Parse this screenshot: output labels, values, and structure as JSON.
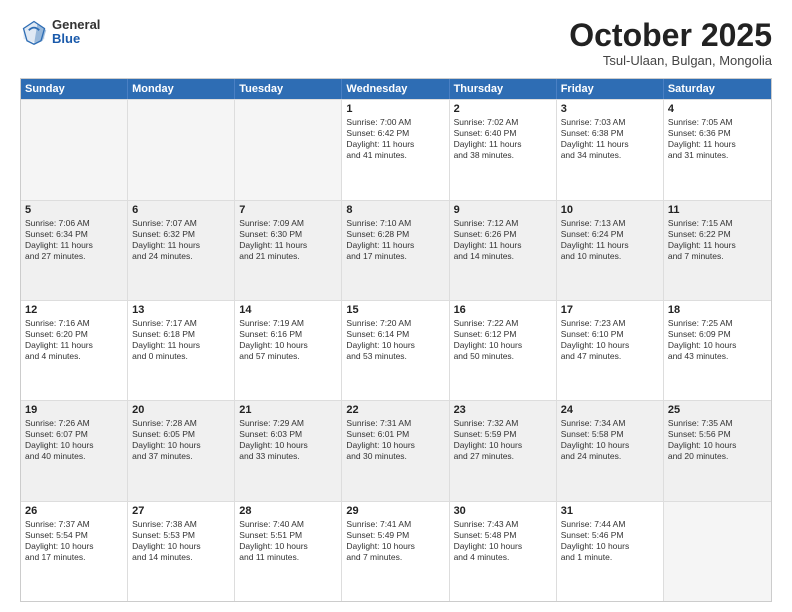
{
  "logo": {
    "general": "General",
    "blue": "Blue"
  },
  "header": {
    "month": "October 2025",
    "location": "Tsul-Ulaan, Bulgan, Mongolia"
  },
  "weekdays": [
    "Sunday",
    "Monday",
    "Tuesday",
    "Wednesday",
    "Thursday",
    "Friday",
    "Saturday"
  ],
  "rows": [
    [
      {
        "day": "",
        "empty": true
      },
      {
        "day": "",
        "empty": true
      },
      {
        "day": "",
        "empty": true
      },
      {
        "day": "1",
        "lines": [
          "Sunrise: 7:00 AM",
          "Sunset: 6:42 PM",
          "Daylight: 11 hours",
          "and 41 minutes."
        ]
      },
      {
        "day": "2",
        "lines": [
          "Sunrise: 7:02 AM",
          "Sunset: 6:40 PM",
          "Daylight: 11 hours",
          "and 38 minutes."
        ]
      },
      {
        "day": "3",
        "lines": [
          "Sunrise: 7:03 AM",
          "Sunset: 6:38 PM",
          "Daylight: 11 hours",
          "and 34 minutes."
        ]
      },
      {
        "day": "4",
        "lines": [
          "Sunrise: 7:05 AM",
          "Sunset: 6:36 PM",
          "Daylight: 11 hours",
          "and 31 minutes."
        ]
      }
    ],
    [
      {
        "day": "5",
        "lines": [
          "Sunrise: 7:06 AM",
          "Sunset: 6:34 PM",
          "Daylight: 11 hours",
          "and 27 minutes."
        ]
      },
      {
        "day": "6",
        "lines": [
          "Sunrise: 7:07 AM",
          "Sunset: 6:32 PM",
          "Daylight: 11 hours",
          "and 24 minutes."
        ]
      },
      {
        "day": "7",
        "lines": [
          "Sunrise: 7:09 AM",
          "Sunset: 6:30 PM",
          "Daylight: 11 hours",
          "and 21 minutes."
        ]
      },
      {
        "day": "8",
        "lines": [
          "Sunrise: 7:10 AM",
          "Sunset: 6:28 PM",
          "Daylight: 11 hours",
          "and 17 minutes."
        ]
      },
      {
        "day": "9",
        "lines": [
          "Sunrise: 7:12 AM",
          "Sunset: 6:26 PM",
          "Daylight: 11 hours",
          "and 14 minutes."
        ]
      },
      {
        "day": "10",
        "lines": [
          "Sunrise: 7:13 AM",
          "Sunset: 6:24 PM",
          "Daylight: 11 hours",
          "and 10 minutes."
        ]
      },
      {
        "day": "11",
        "lines": [
          "Sunrise: 7:15 AM",
          "Sunset: 6:22 PM",
          "Daylight: 11 hours",
          "and 7 minutes."
        ]
      }
    ],
    [
      {
        "day": "12",
        "lines": [
          "Sunrise: 7:16 AM",
          "Sunset: 6:20 PM",
          "Daylight: 11 hours",
          "and 4 minutes."
        ]
      },
      {
        "day": "13",
        "lines": [
          "Sunrise: 7:17 AM",
          "Sunset: 6:18 PM",
          "Daylight: 11 hours",
          "and 0 minutes."
        ]
      },
      {
        "day": "14",
        "lines": [
          "Sunrise: 7:19 AM",
          "Sunset: 6:16 PM",
          "Daylight: 10 hours",
          "and 57 minutes."
        ]
      },
      {
        "day": "15",
        "lines": [
          "Sunrise: 7:20 AM",
          "Sunset: 6:14 PM",
          "Daylight: 10 hours",
          "and 53 minutes."
        ]
      },
      {
        "day": "16",
        "lines": [
          "Sunrise: 7:22 AM",
          "Sunset: 6:12 PM",
          "Daylight: 10 hours",
          "and 50 minutes."
        ]
      },
      {
        "day": "17",
        "lines": [
          "Sunrise: 7:23 AM",
          "Sunset: 6:10 PM",
          "Daylight: 10 hours",
          "and 47 minutes."
        ]
      },
      {
        "day": "18",
        "lines": [
          "Sunrise: 7:25 AM",
          "Sunset: 6:09 PM",
          "Daylight: 10 hours",
          "and 43 minutes."
        ]
      }
    ],
    [
      {
        "day": "19",
        "lines": [
          "Sunrise: 7:26 AM",
          "Sunset: 6:07 PM",
          "Daylight: 10 hours",
          "and 40 minutes."
        ]
      },
      {
        "day": "20",
        "lines": [
          "Sunrise: 7:28 AM",
          "Sunset: 6:05 PM",
          "Daylight: 10 hours",
          "and 37 minutes."
        ]
      },
      {
        "day": "21",
        "lines": [
          "Sunrise: 7:29 AM",
          "Sunset: 6:03 PM",
          "Daylight: 10 hours",
          "and 33 minutes."
        ]
      },
      {
        "day": "22",
        "lines": [
          "Sunrise: 7:31 AM",
          "Sunset: 6:01 PM",
          "Daylight: 10 hours",
          "and 30 minutes."
        ]
      },
      {
        "day": "23",
        "lines": [
          "Sunrise: 7:32 AM",
          "Sunset: 5:59 PM",
          "Daylight: 10 hours",
          "and 27 minutes."
        ]
      },
      {
        "day": "24",
        "lines": [
          "Sunrise: 7:34 AM",
          "Sunset: 5:58 PM",
          "Daylight: 10 hours",
          "and 24 minutes."
        ]
      },
      {
        "day": "25",
        "lines": [
          "Sunrise: 7:35 AM",
          "Sunset: 5:56 PM",
          "Daylight: 10 hours",
          "and 20 minutes."
        ]
      }
    ],
    [
      {
        "day": "26",
        "lines": [
          "Sunrise: 7:37 AM",
          "Sunset: 5:54 PM",
          "Daylight: 10 hours",
          "and 17 minutes."
        ]
      },
      {
        "day": "27",
        "lines": [
          "Sunrise: 7:38 AM",
          "Sunset: 5:53 PM",
          "Daylight: 10 hours",
          "and 14 minutes."
        ]
      },
      {
        "day": "28",
        "lines": [
          "Sunrise: 7:40 AM",
          "Sunset: 5:51 PM",
          "Daylight: 10 hours",
          "and 11 minutes."
        ]
      },
      {
        "day": "29",
        "lines": [
          "Sunrise: 7:41 AM",
          "Sunset: 5:49 PM",
          "Daylight: 10 hours",
          "and 7 minutes."
        ]
      },
      {
        "day": "30",
        "lines": [
          "Sunrise: 7:43 AM",
          "Sunset: 5:48 PM",
          "Daylight: 10 hours",
          "and 4 minutes."
        ]
      },
      {
        "day": "31",
        "lines": [
          "Sunrise: 7:44 AM",
          "Sunset: 5:46 PM",
          "Daylight: 10 hours",
          "and 1 minute."
        ]
      },
      {
        "day": "",
        "empty": true
      }
    ]
  ]
}
